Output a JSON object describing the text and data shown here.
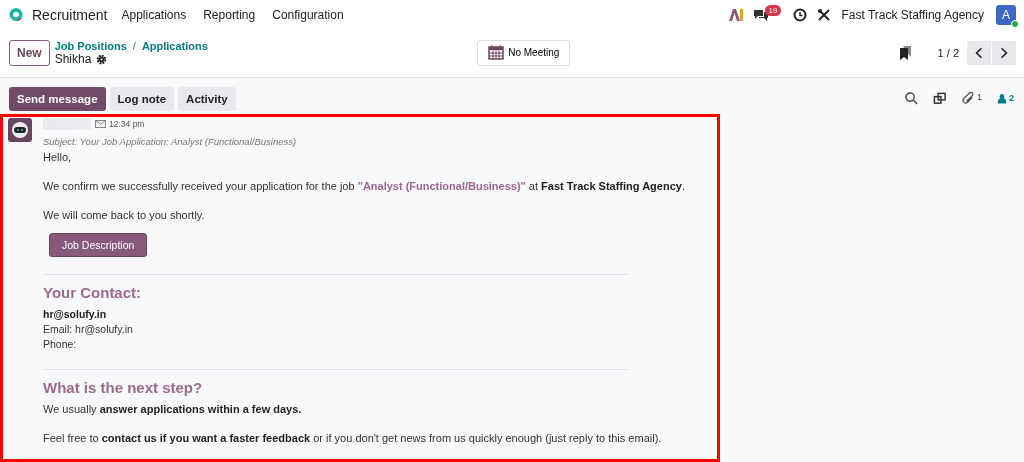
{
  "navbar": {
    "app_name": "Recruitment",
    "menus": [
      "Applications",
      "Reporting",
      "Configuration"
    ],
    "messages_count": "19",
    "company": "Fast Track Staffing Agency",
    "avatar_letter": "A"
  },
  "control_panel": {
    "new_button": "New",
    "breadcrumbs": [
      "Job Positions",
      "Applications"
    ],
    "breadcrumb_separator": "/",
    "record_name": "Shikha",
    "meeting_button": "No Meeting",
    "pager": "1 / 2"
  },
  "chatter": {
    "buttons": [
      {
        "label": "Send message",
        "selected": true
      },
      {
        "label": "Log note",
        "selected": false
      },
      {
        "label": "Activity",
        "selected": false
      }
    ],
    "attachments_count": "1",
    "followers_count": "2"
  },
  "message": {
    "time": "12:34 pm",
    "subject": "Subject: Your Job Application: Analyst (Functional/Business)",
    "blocks": [
      {
        "kind": "para",
        "segments": [
          {
            "kind": "plain",
            "text": "Hello,"
          }
        ]
      },
      {
        "kind": "para",
        "segments": [
          {
            "kind": "plain",
            "text": "We confirm we successfully received your application for the job "
          },
          {
            "kind": "accent",
            "text": "\"Analyst (Functional/Business)\""
          },
          {
            "kind": "plain",
            "text": " at "
          },
          {
            "kind": "bold",
            "text": "Fast Track Staffing Agency"
          },
          {
            "kind": "plain",
            "text": "."
          }
        ]
      },
      {
        "kind": "para",
        "segments": [
          {
            "kind": "plain",
            "text": "We will come back to you shortly."
          }
        ]
      },
      {
        "kind": "button",
        "text": "Job Description"
      },
      {
        "kind": "rule"
      },
      {
        "kind": "heading",
        "text": "Your Contact:"
      },
      {
        "kind": "lines",
        "lines": [
          {
            "kind": "bold",
            "text": "hr@solufy.in"
          },
          {
            "kind": "plain",
            "text": "Email: hr@solufy.in"
          },
          {
            "kind": "plain",
            "text": "Phone:"
          }
        ]
      },
      {
        "kind": "rule"
      },
      {
        "kind": "heading",
        "text": "What is the next step?"
      },
      {
        "kind": "para",
        "segments": [
          {
            "kind": "plain",
            "text": "We usually "
          },
          {
            "kind": "bold",
            "text": "answer applications within a few days."
          }
        ]
      },
      {
        "kind": "para",
        "segments": [
          {
            "kind": "plain",
            "text": "Feel free to "
          },
          {
            "kind": "bold",
            "text": "contact us if you want a faster feedback"
          },
          {
            "kind": "plain",
            "text": " or if you don't get news from us quickly enough (just reply to this email)."
          }
        ]
      }
    ]
  }
}
